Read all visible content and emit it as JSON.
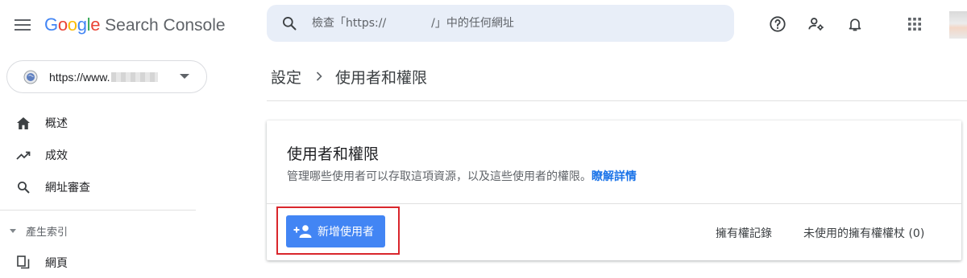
{
  "app": {
    "logo_letters": [
      {
        "ch": "G",
        "color": "#4285F4"
      },
      {
        "ch": "o",
        "color": "#EA4335"
      },
      {
        "ch": "o",
        "color": "#FBBC05"
      },
      {
        "ch": "g",
        "color": "#4285F4"
      },
      {
        "ch": "l",
        "color": "#34A853"
      },
      {
        "ch": "e",
        "color": "#EA4335"
      }
    ],
    "product": "Search Console"
  },
  "search": {
    "placeholder": "檢查「https://    /」中的任何網址",
    "icon": "search-icon"
  },
  "top_icons": [
    "help-icon",
    "manage-users-icon",
    "notifications-icon",
    "apps-grid-icon"
  ],
  "property": {
    "url": "https://www."
  },
  "sidebar": {
    "items": [
      {
        "label": "概述",
        "icon": "home-icon"
      },
      {
        "label": "成效",
        "icon": "trending-up-icon"
      },
      {
        "label": "網址審查",
        "icon": "search-icon"
      }
    ],
    "section_label": "產生索引",
    "section_items": [
      {
        "label": "網頁",
        "icon": "pages-icon"
      }
    ]
  },
  "breadcrumb": {
    "parent": "設定",
    "current": "使用者和權限"
  },
  "card": {
    "title": "使用者和權限",
    "description": "管理哪些使用者可以存取這項資源，以及這些使用者的權限。",
    "learn_more": "瞭解詳情",
    "add_user_label": "新增使用者",
    "ownership_history": "擁有權記錄",
    "unused_tokens": "未使用的擁有權權杖 (0)"
  },
  "colors": {
    "accent_button": "#4285f4",
    "link": "#1a73e8",
    "highlight_box": "#d9262c",
    "search_bg": "#e8eef8"
  }
}
